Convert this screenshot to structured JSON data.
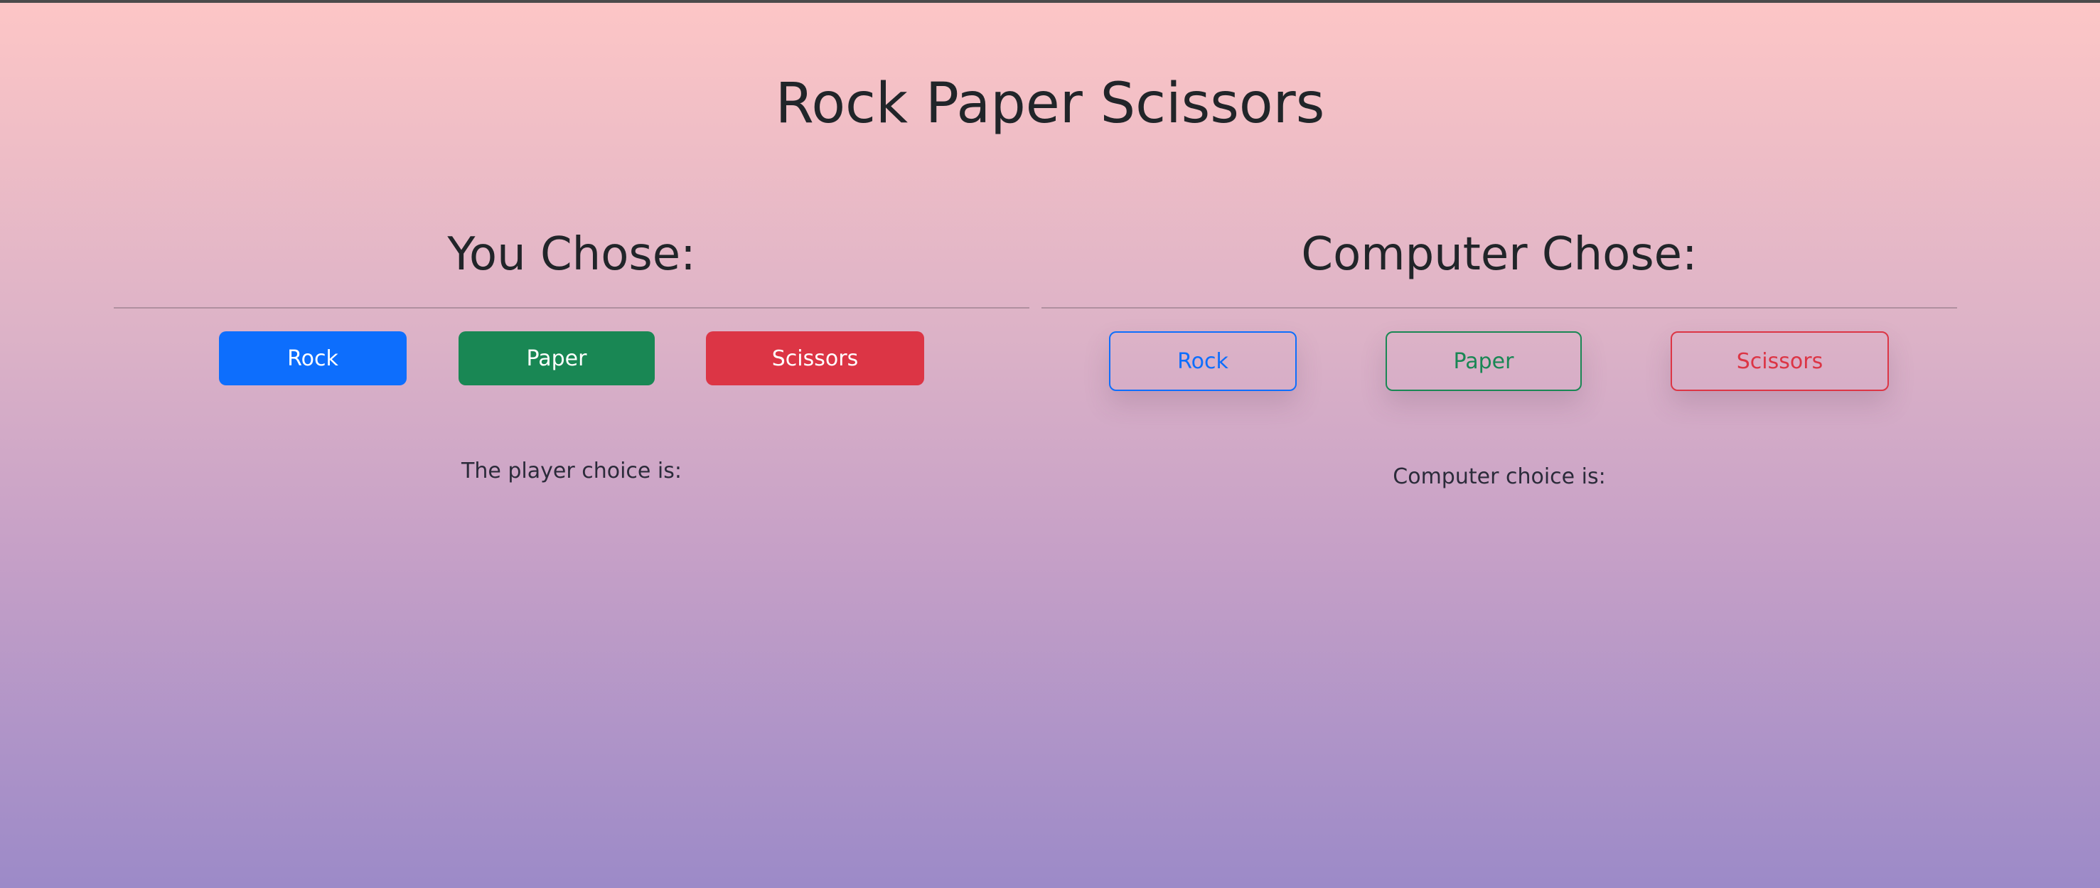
{
  "title": "Rock Paper Scissors",
  "player": {
    "heading": "You Chose:",
    "buttons": {
      "rock": "Rock",
      "paper": "Paper",
      "scissors": "Scissors"
    },
    "choice_text": "The player choice is:"
  },
  "computer": {
    "heading": "Computer Chose:",
    "buttons": {
      "rock": "Rock",
      "paper": "Paper",
      "scissors": "Scissors"
    },
    "choice_text": "Computer choice is:"
  },
  "colors": {
    "rock": "#0d6efd",
    "paper": "#198754",
    "scissors": "#dc3545"
  }
}
